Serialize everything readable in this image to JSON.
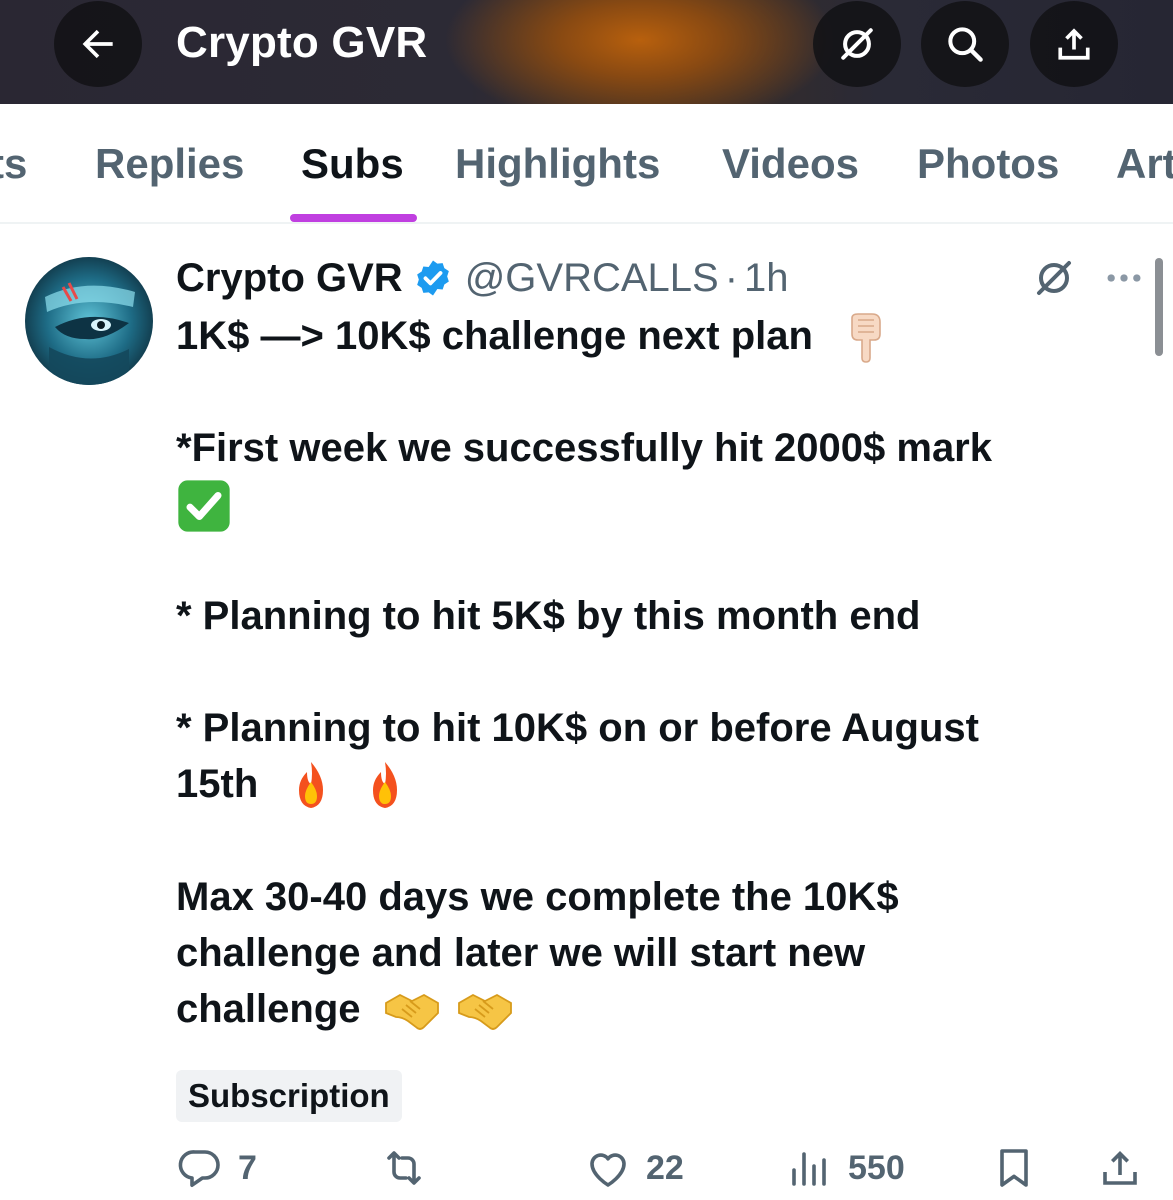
{
  "header": {
    "title": "Crypto GVR",
    "back_icon": "back-arrow-icon",
    "icons": [
      "grok-icon",
      "search-icon",
      "share-icon"
    ]
  },
  "tabs": [
    {
      "label": "ts"
    },
    {
      "label": "Replies"
    },
    {
      "label": "Subs",
      "active": true
    },
    {
      "label": "Highlights"
    },
    {
      "label": "Videos"
    },
    {
      "label": "Photos"
    },
    {
      "label": "Art"
    }
  ],
  "accent_color": "#c03fe0",
  "post": {
    "author": "Crypto GVR",
    "handle": "@GVRCALLS",
    "separator": "·",
    "time": "1h",
    "lines": [
      "1K$ —> 10K$ challenge next plan",
      "*First week we successfully hit 2000$ mark",
      "* Planning to hit 5K$ by this month end",
      "* Planning to hit 10K$ on or before August",
      "15th",
      "Max 30-40 days we complete the 10K$",
      "challenge and later we will start new",
      "challenge"
    ],
    "badge": "Subscription",
    "actions": {
      "replies": "7",
      "reposts": "",
      "likes": "22",
      "views": "550"
    }
  }
}
